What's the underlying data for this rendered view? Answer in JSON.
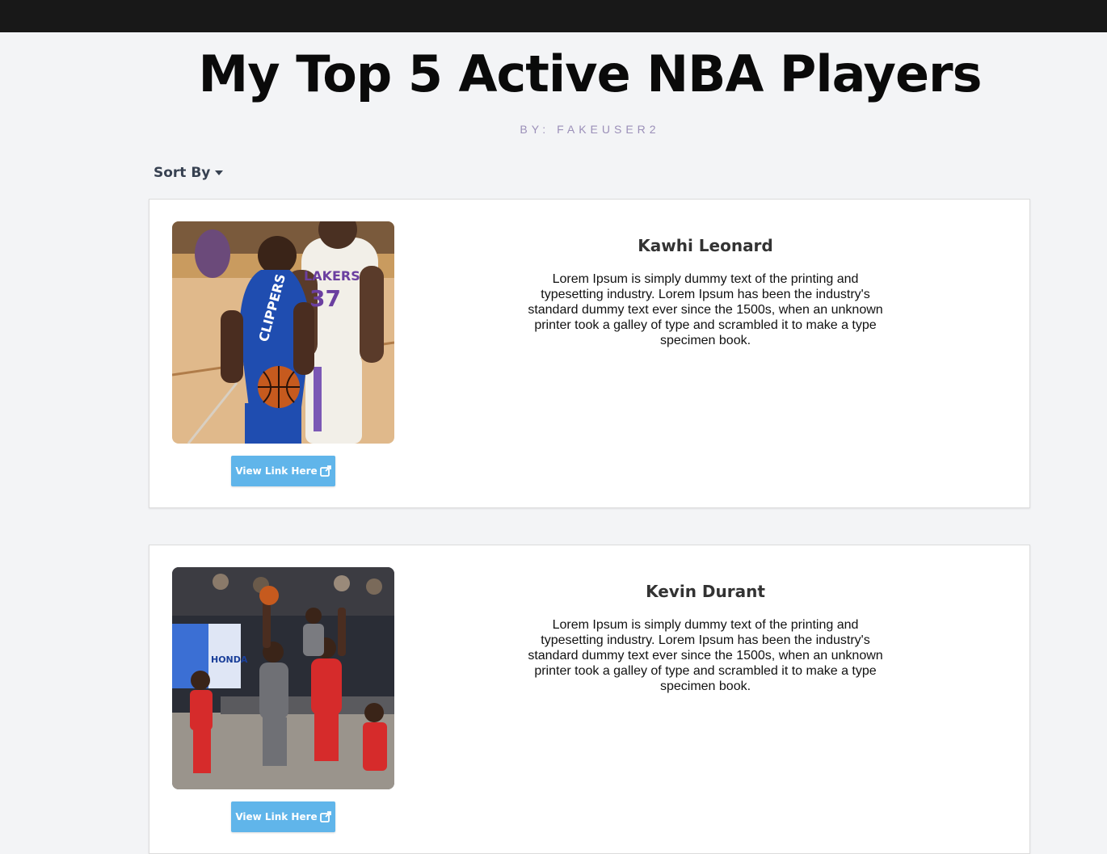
{
  "header": {
    "title": "My Top 5 Active NBA Players",
    "byline": "BY: FAKEUSER2"
  },
  "controls": {
    "sort_label": "Sort By"
  },
  "players": [
    {
      "name": "Kawhi Leonard",
      "description": "Lorem Ipsum is simply dummy text of the printing and typesetting industry. Lorem Ipsum has been the industry's standard dummy text ever since the 1500s, when an unknown printer took a galley of type and scrambled it to make a type specimen book.",
      "link_label": "View Link Here",
      "photo_icon": "player-photo",
      "jersey_number": "37",
      "jersey_text": "LAKERS"
    },
    {
      "name": "Kevin Durant",
      "description": "Lorem Ipsum is simply dummy text of the printing and typesetting industry. Lorem Ipsum has been the industry's standard dummy text ever since the 1500s, when an unknown printer took a galley of type and scrambled it to make a type specimen book.",
      "link_label": "View Link Here",
      "photo_icon": "player-photo",
      "sponsor_text": "HONDA"
    }
  ],
  "colors": {
    "topbar": "#181818",
    "background": "#f3f4f6",
    "byline": "#9b8fb8",
    "button": "#60b5ea"
  }
}
